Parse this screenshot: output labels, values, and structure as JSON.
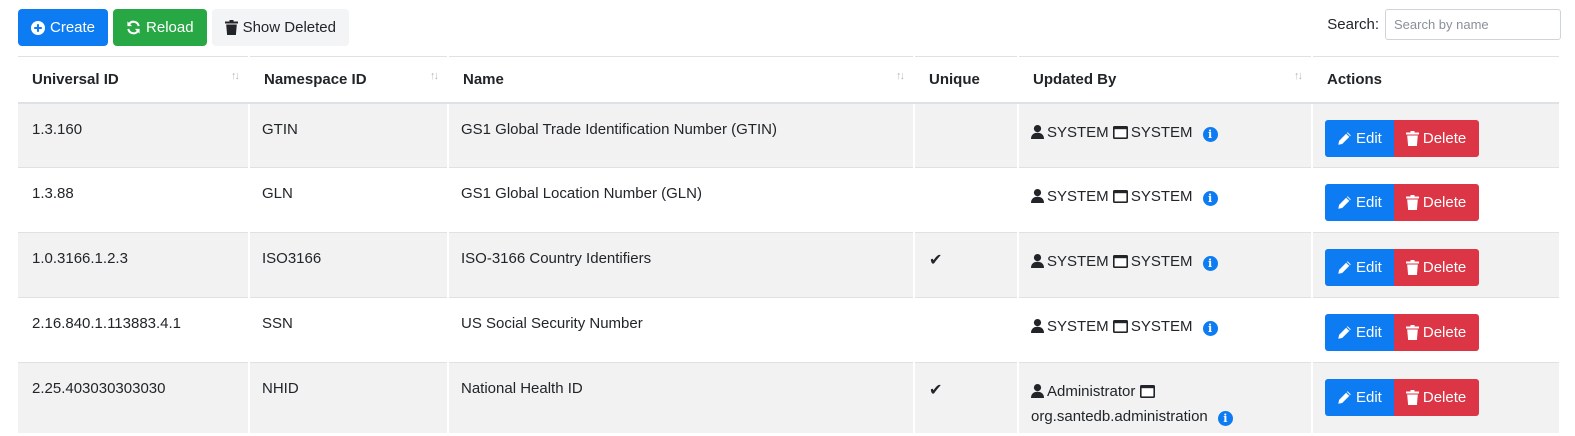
{
  "toolbar": {
    "create_label": "Create",
    "reload_label": "Reload",
    "show_deleted_label": "Show Deleted"
  },
  "search": {
    "label": "Search:",
    "placeholder": "Search by name",
    "value": ""
  },
  "table": {
    "columns": [
      "Universal ID",
      "Namespace ID",
      "Name",
      "Unique",
      "Updated By",
      "Actions"
    ],
    "rows": [
      {
        "universal_id": "1.3.160",
        "namespace_id": "GTIN",
        "name": "GS1 Global Trade Identification Number (GTIN)",
        "unique": "",
        "updated_user": "SYSTEM",
        "updated_app": "SYSTEM"
      },
      {
        "universal_id": "1.3.88",
        "namespace_id": "GLN",
        "name": "GS1 Global Location Number (GLN)",
        "unique": "",
        "updated_user": "SYSTEM",
        "updated_app": "SYSTEM"
      },
      {
        "universal_id": "1.0.3166.1.2.3",
        "namespace_id": "ISO3166",
        "name": "ISO-3166 Country Identifiers",
        "unique": "✔",
        "updated_user": "SYSTEM",
        "updated_app": "SYSTEM"
      },
      {
        "universal_id": "2.16.840.1.113883.4.1",
        "namespace_id": "SSN",
        "name": "US Social Security Number",
        "unique": "",
        "updated_user": "SYSTEM",
        "updated_app": "SYSTEM"
      },
      {
        "universal_id": "2.25.403030303030",
        "namespace_id": "NHID",
        "name": "National Health ID",
        "unique": "✔",
        "updated_user": "Administrator",
        "updated_app": "org.santedb.administration"
      }
    ],
    "edit_label": "Edit",
    "delete_label": "Delete"
  },
  "colors": {
    "primary": "#0d7cf2",
    "success": "#28a745",
    "danger": "#dc3545",
    "stripe": "#f2f2f2"
  },
  "icons": {
    "create": "plus-circle-icon",
    "reload": "sync-icon",
    "show_deleted": "trash-icon",
    "user": "user-icon",
    "application": "window-icon",
    "info": "info-circle-icon",
    "edit": "pencil-icon",
    "delete": "trash-icon",
    "sort": "sort-arrows-icon",
    "check": "check-icon"
  }
}
